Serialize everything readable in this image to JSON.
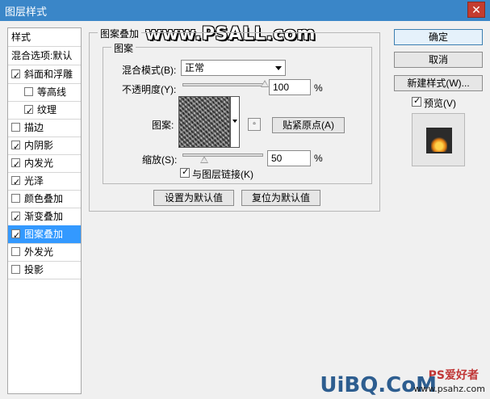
{
  "window": {
    "title": "图层样式",
    "close_glyph": "✕"
  },
  "watermark": "www.PSALL.com",
  "sidebar": {
    "header": "样式",
    "blend_options": "混合选项:默认",
    "items": [
      {
        "label": "斜面和浮雕",
        "checked": true
      },
      {
        "label": "等高线",
        "checked": false
      },
      {
        "label": "纹理",
        "checked": true
      },
      {
        "label": "描边",
        "checked": false
      },
      {
        "label": "内阴影",
        "checked": true
      },
      {
        "label": "内发光",
        "checked": true
      },
      {
        "label": "光泽",
        "checked": true
      },
      {
        "label": "颜色叠加",
        "checked": false
      },
      {
        "label": "渐变叠加",
        "checked": true
      },
      {
        "label": "图案叠加",
        "checked": true,
        "selected": true
      },
      {
        "label": "外发光",
        "checked": false
      },
      {
        "label": "投影",
        "checked": false
      }
    ]
  },
  "panel": {
    "group_title": "图案叠加",
    "subgroup_title": "图案",
    "blend_mode_label": "混合模式(B):",
    "blend_mode_value": "正常",
    "opacity_label": "不透明度(Y):",
    "opacity_value": "100",
    "opacity_unit": "%",
    "opacity_level": 1.0,
    "pattern_label": "图案:",
    "snap_origin_button": "贴紧原点(A)",
    "scale_label": "缩放(S):",
    "scale_value": "50",
    "scale_unit": "%",
    "scale_level": 0.05,
    "link_checkbox_label": "与图层链接(K)",
    "link_checked": true,
    "make_default_button": "设置为默认值",
    "reset_default_button": "复位为默认值"
  },
  "actions": {
    "ok": "确定",
    "cancel": "取消",
    "new_style": "新建样式(W)...",
    "preview_label": "预览(V)",
    "preview_checked": true
  },
  "footer_logo": {
    "brand": "UiBQ.CoM",
    "chinese": "PS爱好者",
    "site": "www.psahz.com"
  }
}
